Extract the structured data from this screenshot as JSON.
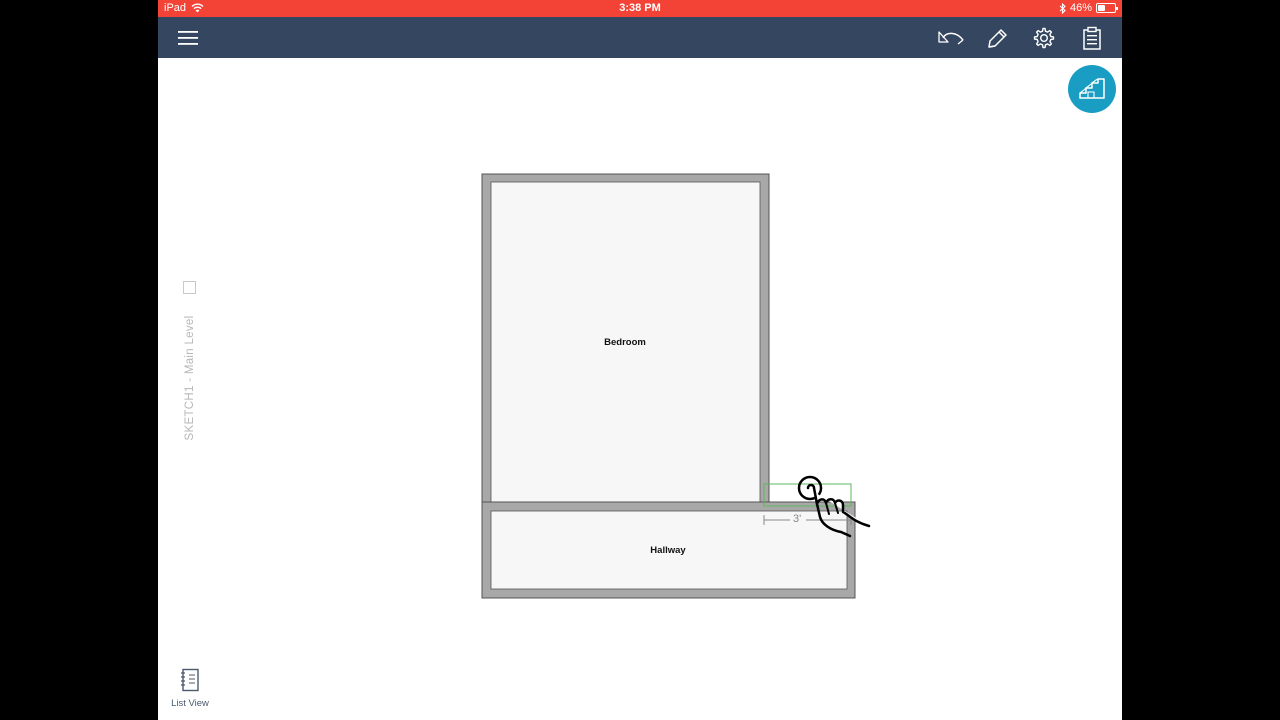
{
  "status_bar": {
    "device": "iPad",
    "time": "3:38 PM",
    "battery": "46%",
    "battery_level": 0.46
  },
  "toolbar": {
    "menu_icon": "hamburger-menu-icon",
    "actions": [
      {
        "name": "undo",
        "icon": "undo-icon"
      },
      {
        "name": "edit",
        "icon": "pencil-icon"
      },
      {
        "name": "settings",
        "icon": "gear-icon"
      },
      {
        "name": "report",
        "icon": "clipboard-icon"
      }
    ]
  },
  "fab": {
    "icon": "stairs-icon",
    "color": "#1a9dc3"
  },
  "level": {
    "label": "SKETCH1 - Main Level"
  },
  "rooms": [
    {
      "name": "Bedroom"
    },
    {
      "name": "Hallway"
    }
  ],
  "dimension": {
    "label": "3'"
  },
  "footer": {
    "list_view_label": "List View"
  },
  "colors": {
    "status_bar": "#f34336",
    "toolbar": "#354660",
    "wall": "#a8a8a8",
    "selection": "#5cb85c"
  }
}
